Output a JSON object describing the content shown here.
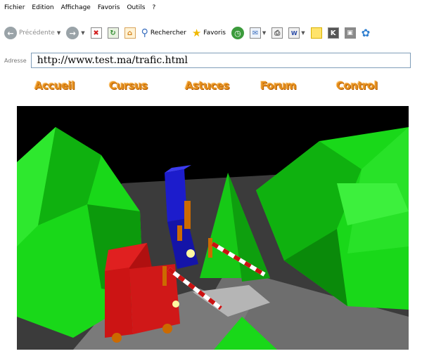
{
  "menu": {
    "items": [
      "Fichier",
      "Edition",
      "Affichage",
      "Favoris",
      "Outils",
      "?"
    ]
  },
  "toolbar": {
    "back_label": "Précédente",
    "search_label": "Rechercher",
    "favorites_label": "Favoris"
  },
  "address": {
    "label": "Adresse",
    "url": "http://www.test.ma/trafic.html"
  },
  "site_nav": {
    "items": [
      "Accueil",
      "Cursus",
      "Astuces",
      "Forum",
      "Control"
    ],
    "color": "#e58f1c"
  },
  "scene": {
    "colors": {
      "sky": "#000000",
      "mountain": "#19d819",
      "road": "#3b3b3b",
      "blue_truck": "#1c1ccc",
      "red_truck": "#cc1414",
      "barrier_red": "#cc1111",
      "barrier_white": "#ffffff"
    }
  }
}
